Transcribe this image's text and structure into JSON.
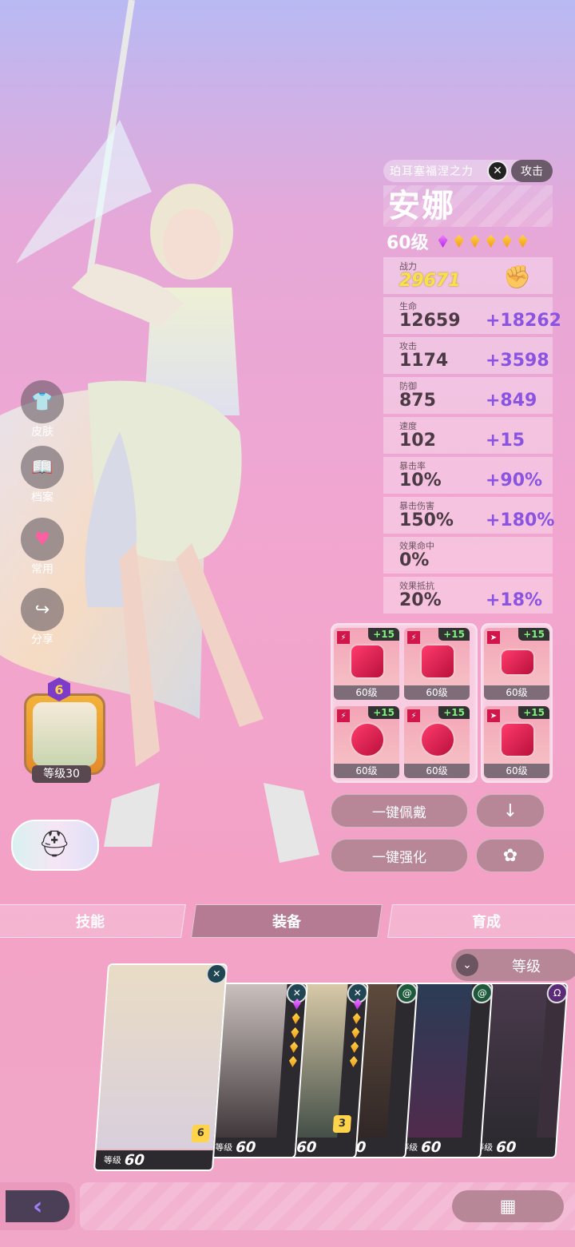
{
  "hero": {
    "faction": "珀耳塞福涅之力",
    "element_icon": "wind-cross-icon",
    "role": "攻击",
    "name": "安娜",
    "level": "60级",
    "purple_stars": 1,
    "gold_stars": 5
  },
  "stats": [
    {
      "label": "战力",
      "value": "29671",
      "bonus": ""
    },
    {
      "label": "生命",
      "value": "12659",
      "bonus": "+18262"
    },
    {
      "label": "攻击",
      "value": "1174",
      "bonus": "+3598"
    },
    {
      "label": "防御",
      "value": "875",
      "bonus": "+849"
    },
    {
      "label": "速度",
      "value": "102",
      "bonus": "+15"
    },
    {
      "label": "暴击率",
      "value": "10%",
      "bonus": "+90%"
    },
    {
      "label": "暴击伤害",
      "value": "150%",
      "bonus": "+180%"
    },
    {
      "label": "效果命中",
      "value": "0%",
      "bonus": ""
    },
    {
      "label": "效果抵抗",
      "value": "20%",
      "bonus": "+18%"
    }
  ],
  "equipment": [
    {
      "name": "sword-icon",
      "plus": "+15",
      "level": "60级"
    },
    {
      "name": "armor-icon",
      "plus": "+15",
      "level": "60级"
    },
    {
      "name": "goggles-icon",
      "plus": "+15",
      "level": "60级"
    },
    {
      "name": "ring-icon",
      "plus": "+15",
      "level": "60级"
    },
    {
      "name": "headphones-icon",
      "plus": "+15",
      "level": "60级"
    },
    {
      "name": "boots-icon",
      "plus": "+15",
      "level": "60级"
    }
  ],
  "actions": {
    "equip_all": "一键佩戴",
    "upgrade_all": "一键强化",
    "unequip_icon": "↓",
    "settings_icon": "✿"
  },
  "side_menu": [
    {
      "label": "皮肤",
      "icon": "shirt-icon"
    },
    {
      "label": "档案",
      "icon": "book-icon"
    },
    {
      "label": "常用",
      "icon": "heart-icon"
    },
    {
      "label": "分享",
      "icon": "share-icon"
    }
  ],
  "portrait": {
    "rank": "6",
    "level": "等级30"
  },
  "tabs": [
    "技能",
    "装备",
    "育成"
  ],
  "sort": {
    "label": "等级"
  },
  "roster": [
    {
      "level_label": "等级",
      "level": "60",
      "badge": "6"
    },
    {
      "level_label": "等级",
      "level": "60",
      "badge": ""
    },
    {
      "level_label": "等级",
      "level": "60",
      "badge": "3"
    },
    {
      "level_label": "等级",
      "level": "60",
      "badge": ""
    },
    {
      "level_label": "等级",
      "level": "60",
      "badge": ""
    },
    {
      "level_label": "等级",
      "level": "60",
      "badge": ""
    }
  ],
  "nav": {
    "back": "‹",
    "grid": "▦"
  }
}
